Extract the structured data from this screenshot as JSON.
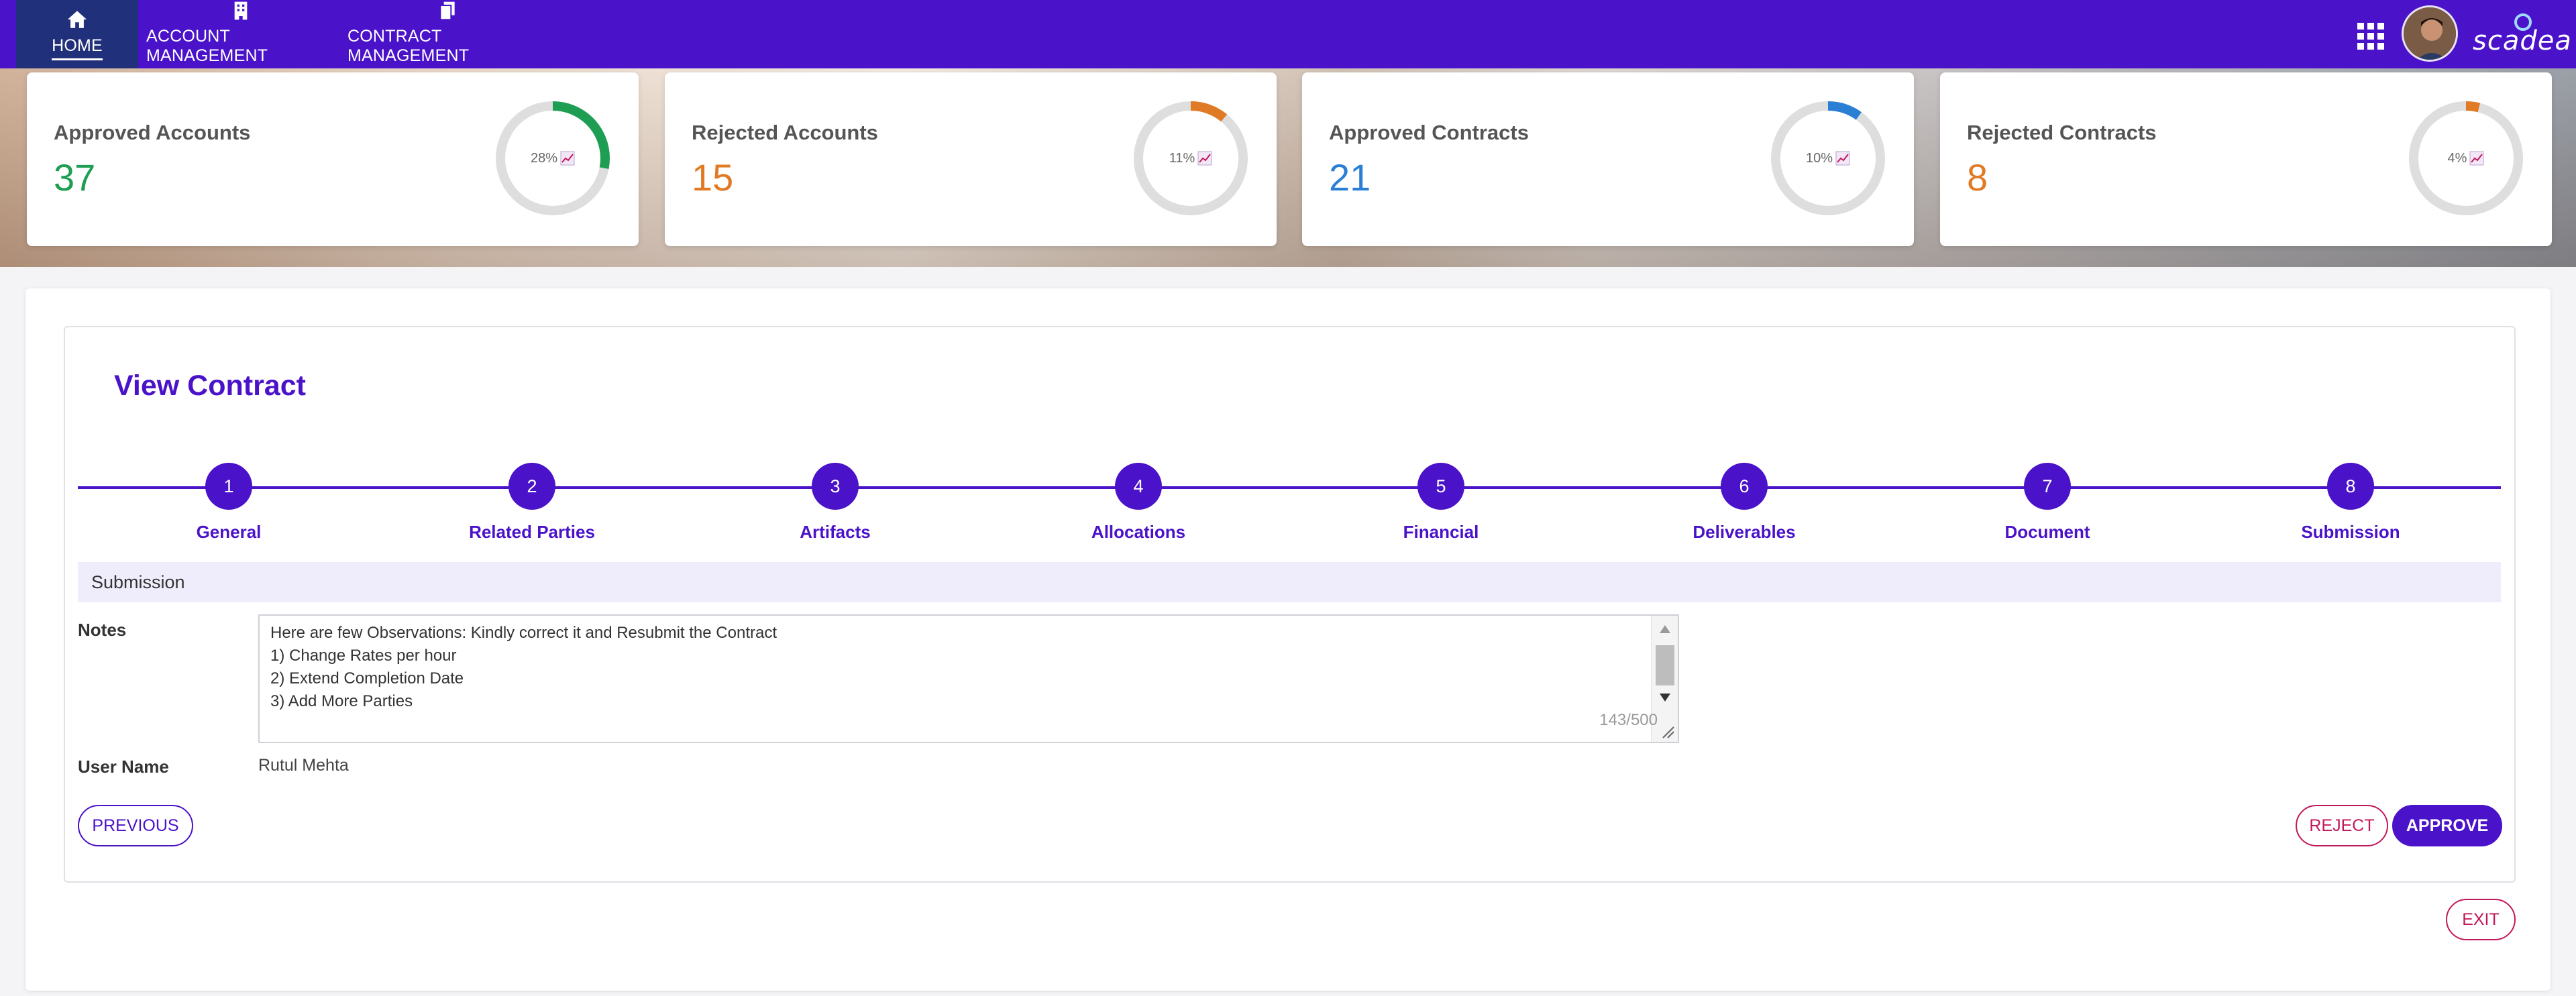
{
  "nav": {
    "items": [
      {
        "label": "HOME",
        "icon": "home-icon",
        "active": true
      },
      {
        "label": "ACCOUNT MANAGEMENT",
        "icon": "building-icon",
        "active": false
      },
      {
        "label": "CONTRACT MANAGEMENT",
        "icon": "documents-icon",
        "active": false
      }
    ],
    "apps_icon": "grid-icon",
    "brand": "scadea"
  },
  "stats": [
    {
      "title": "Approved Accounts",
      "value": "37",
      "percent_label": "28%",
      "percent": 28,
      "color": "#1e9e52"
    },
    {
      "title": "Rejected Accounts",
      "value": "15",
      "percent_label": "11%",
      "percent": 11,
      "color": "#e07a24"
    },
    {
      "title": "Approved Contracts",
      "value": "21",
      "percent_label": "10%",
      "percent": 10,
      "color": "#2a7fd4"
    },
    {
      "title": "Rejected Contracts",
      "value": "8",
      "percent_label": "4%",
      "percent": 4,
      "color": "#e07a24"
    }
  ],
  "page": {
    "title": "View Contract"
  },
  "steps": [
    {
      "num": "1",
      "label": "General"
    },
    {
      "num": "2",
      "label": "Related Parties"
    },
    {
      "num": "3",
      "label": "Artifacts"
    },
    {
      "num": "4",
      "label": "Allocations"
    },
    {
      "num": "5",
      "label": "Financial"
    },
    {
      "num": "6",
      "label": "Deliverables"
    },
    {
      "num": "7",
      "label": "Document"
    },
    {
      "num": "8",
      "label": "Submission"
    }
  ],
  "submission": {
    "section_title": "Submission",
    "notes_label": "Notes",
    "notes_lines": [
      "Here are few Observations: Kindly correct it and Resubmit the Contract",
      "1) Change Rates per hour",
      "2) Extend Completion Date",
      "3) Add More Parties"
    ],
    "char_count": "143/500",
    "user_label": "User Name",
    "user_value": "Rutul Mehta"
  },
  "buttons": {
    "previous": "PREVIOUS",
    "reject": "REJECT",
    "approve": "APPROVE",
    "exit": "EXIT"
  },
  "colors": {
    "primary": "#4a12c9",
    "nav_active": "#21307b",
    "danger": "#c2185b"
  }
}
